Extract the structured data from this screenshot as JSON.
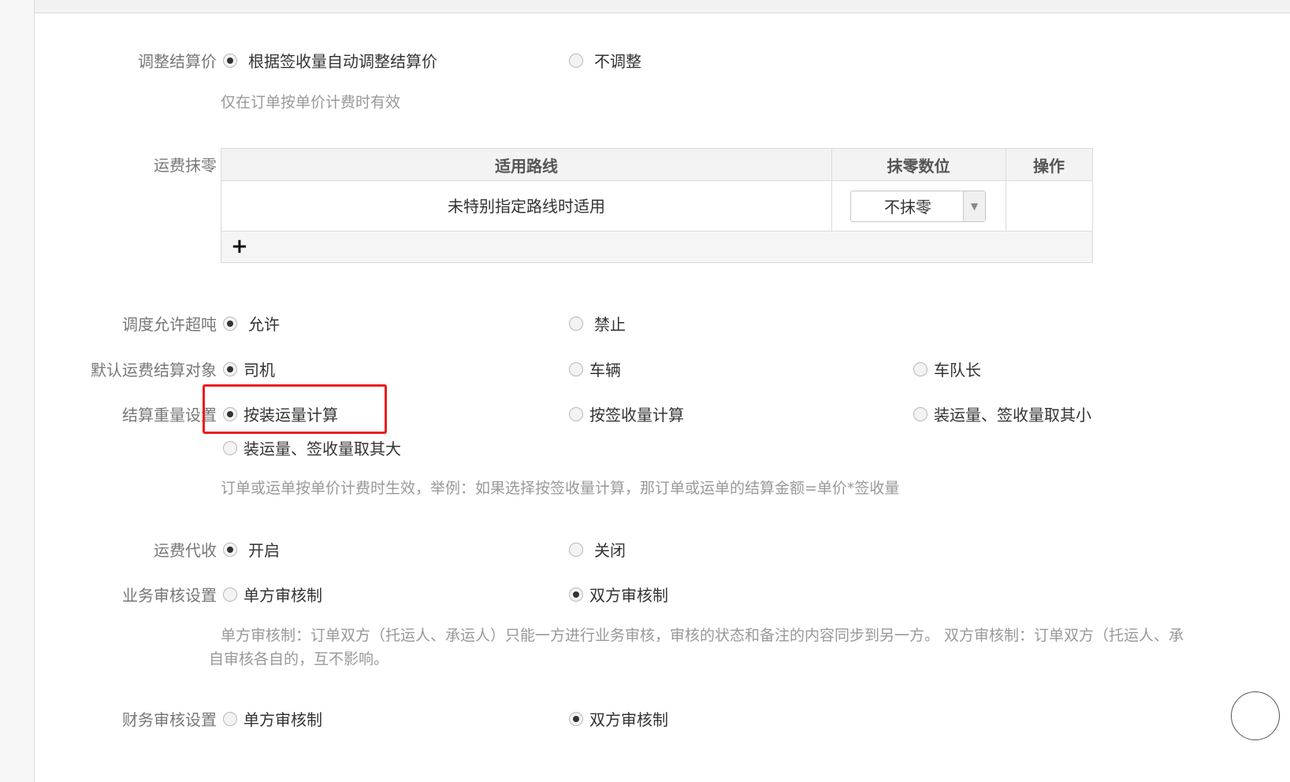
{
  "settlement_adjust": {
    "label": "调整结算价",
    "options": [
      "根据签收量自动调整结算价",
      "不调整"
    ],
    "selected": 0,
    "hint": "仅在订单按单价计费时有效"
  },
  "freight_rounding": {
    "label": "运费抹零",
    "columns": [
      "适用路线",
      "抹零数位",
      "操作"
    ],
    "rows": [
      {
        "route": "未特别指定路线时适用",
        "digit": "不抹零",
        "action": ""
      }
    ],
    "add_icon": "plus-icon"
  },
  "dispatch_overweight": {
    "label": "调度允许超吨",
    "options": [
      "允许",
      "禁止"
    ],
    "selected": 0
  },
  "default_settle_target": {
    "label": "默认运费结算对象",
    "options": [
      "司机",
      "车辆",
      "车队长"
    ],
    "selected": 0
  },
  "settle_weight": {
    "label": "结算重量设置",
    "options": [
      "按装运量计算",
      "按签收量计算",
      "装运量、签收量取其小",
      "装运量、签收量取其大"
    ],
    "selected": 0,
    "hint": "订单或运单按单价计费时生效，举例：如果选择按签收量计算，那订单或运单的结算金额=单价*签收量"
  },
  "freight_collection": {
    "label": "运费代收",
    "options": [
      "开启",
      "关闭"
    ],
    "selected": 0
  },
  "business_audit": {
    "label": "业务审核设置",
    "options": [
      "单方审核制",
      "双方审核制"
    ],
    "selected": 1,
    "desc_line1": "单方审核制：订单双方（托运人、承运人）只能一方进行业务审核，审核的状态和备注的内容同步到另一方。 双方审核制：订单双方（托运人、承",
    "desc_line2": "自审核各自的，互不影响。"
  },
  "finance_audit": {
    "label": "财务审核设置",
    "options": [
      "单方审核制",
      "双方审核制"
    ],
    "selected": 1
  },
  "colors": {
    "highlight": "#ee1c1c",
    "label_text": "#777777",
    "hint_text": "#999999"
  }
}
